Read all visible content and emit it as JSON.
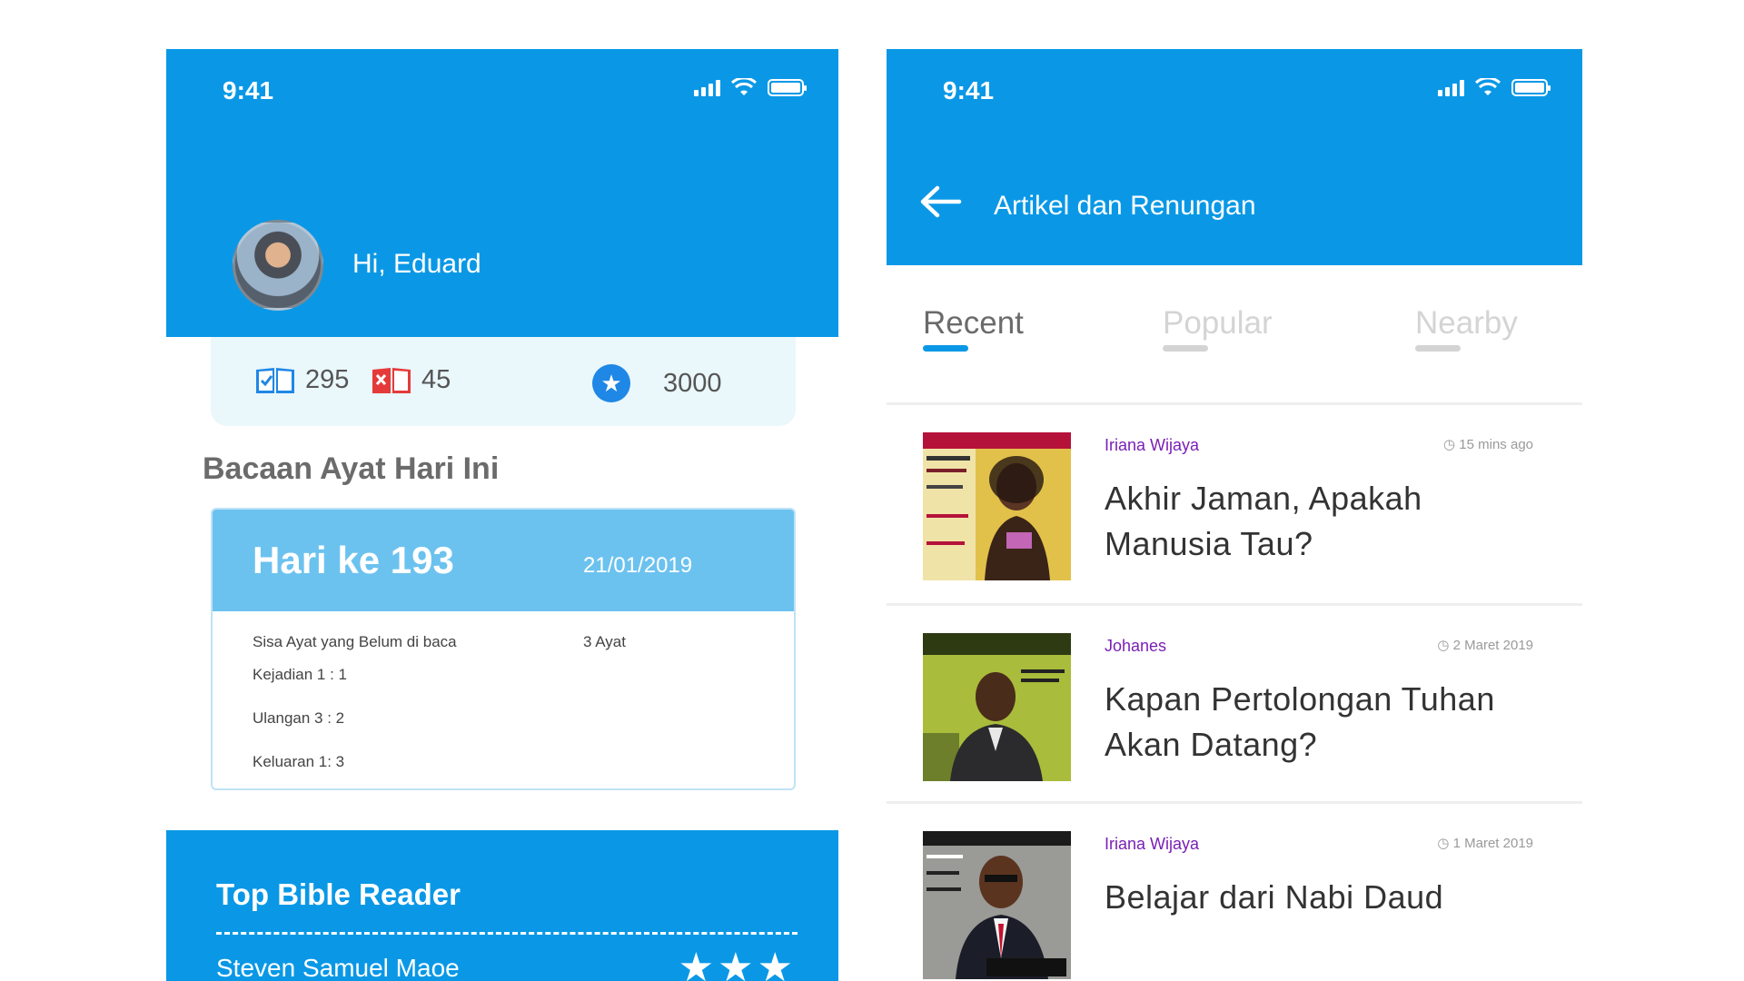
{
  "left_screen": {
    "status_time": "9:41",
    "greeting": "Hi, Eduard",
    "stats": {
      "read_count": "295",
      "unread_count": "45",
      "points": "3000"
    },
    "section_title": "Bacaan Ayat Hari Ini",
    "day_card": {
      "title": "Hari ke 193",
      "date": "21/01/2019",
      "remaining_label": "Sisa Ayat yang Belum di baca",
      "remaining_value": "3 Ayat",
      "verses": [
        "Kejadian 1 : 1",
        "Ulangan 3 : 2",
        "Keluaran 1: 3"
      ]
    },
    "top_reader": {
      "title": "Top Bible Reader",
      "name": "Steven Samuel Maoe",
      "stars": "★★★",
      "rating": 3
    }
  },
  "right_screen": {
    "status_time": "9:41",
    "title": "Artikel dan Renungan",
    "tabs": [
      {
        "label": "Recent",
        "active": true
      },
      {
        "label": "Popular",
        "active": false
      },
      {
        "label": "Nearby",
        "active": false
      }
    ],
    "articles": [
      {
        "author": "Iriana Wijaya",
        "time": "15 mins ago",
        "title": "Akhir Jaman, Apakah Manusia Tau?",
        "thumb_icon": "magazine-woman-cover"
      },
      {
        "author": "Johanes",
        "time": "2 Maret 2019",
        "title": "Kapan Pertolongan Tuhan Akan Datang?",
        "thumb_icon": "magazine-biblestudy-cover"
      },
      {
        "author": "Iriana Wijaya",
        "time": "1 Maret 2019",
        "title": "Belajar dari Nabi Daud",
        "thumb_icon": "magazine-bishop-cover"
      }
    ]
  },
  "colors": {
    "primary": "#0a98e6",
    "card_head": "#6cc2ef",
    "stats_bg": "#eaf7fb",
    "author": "#7a1fb5",
    "tab_inactive": "#cfcfcf"
  }
}
